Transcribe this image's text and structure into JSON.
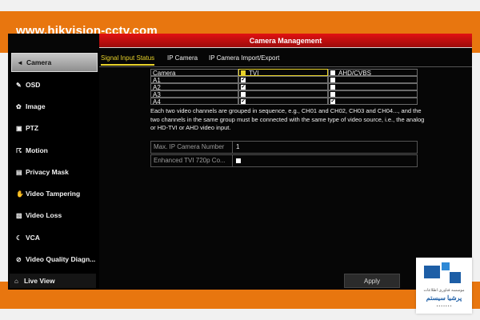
{
  "banner": {
    "url": "www.hikvision-cctv.com"
  },
  "window": {
    "title": "Camera Management"
  },
  "sidebar": {
    "items": [
      {
        "label": "Camera",
        "icon": "camera-icon",
        "active": true
      },
      {
        "label": "OSD",
        "icon": "osd-icon"
      },
      {
        "label": "Image",
        "icon": "image-icon"
      },
      {
        "label": "PTZ",
        "icon": "ptz-icon"
      },
      {
        "label": "Motion",
        "icon": "motion-icon"
      },
      {
        "label": "Privacy Mask",
        "icon": "privacy-mask-icon"
      },
      {
        "label": "Video Tampering",
        "icon": "hand-icon"
      },
      {
        "label": "Video Loss",
        "icon": "video-loss-icon"
      },
      {
        "label": "VCA",
        "icon": "vca-icon"
      },
      {
        "label": "Video Quality Diagn...",
        "icon": "diagnostic-icon"
      }
    ],
    "live_view": "Live View"
  },
  "tabs": [
    {
      "label": "Signal Input Status",
      "active": true
    },
    {
      "label": "IP Camera"
    },
    {
      "label": "IP Camera Import/Export"
    }
  ],
  "signal_table": {
    "headers": [
      "Camera",
      "TVI",
      "AHD/CVBS"
    ],
    "rows": [
      {
        "camera": "A1",
        "tvi": true,
        "ahd": false
      },
      {
        "camera": "A2",
        "tvi": true,
        "ahd": false
      },
      {
        "camera": "A3",
        "tvi": false,
        "ahd": false
      },
      {
        "camera": "A4",
        "tvi": true,
        "ahd": true
      }
    ]
  },
  "info_text": "Each two video channels are grouped in sequence, e.g., CH01 and CH02, CH03 and CH04..., and the two channels in the same group must be connected with the same type of video source, i.e., the analog or HD-TVI or AHD video input.",
  "settings": {
    "max_ip_label": "Max. IP Camera Number",
    "max_ip_value": "1",
    "enhanced_label": "Enhanced TVI 720p Co...",
    "enhanced_checked": false
  },
  "apply_label": "Apply",
  "colors": {
    "accent_orange": "#e8760f",
    "title_red": "#c51111",
    "tab_active": "#e8d22a"
  }
}
